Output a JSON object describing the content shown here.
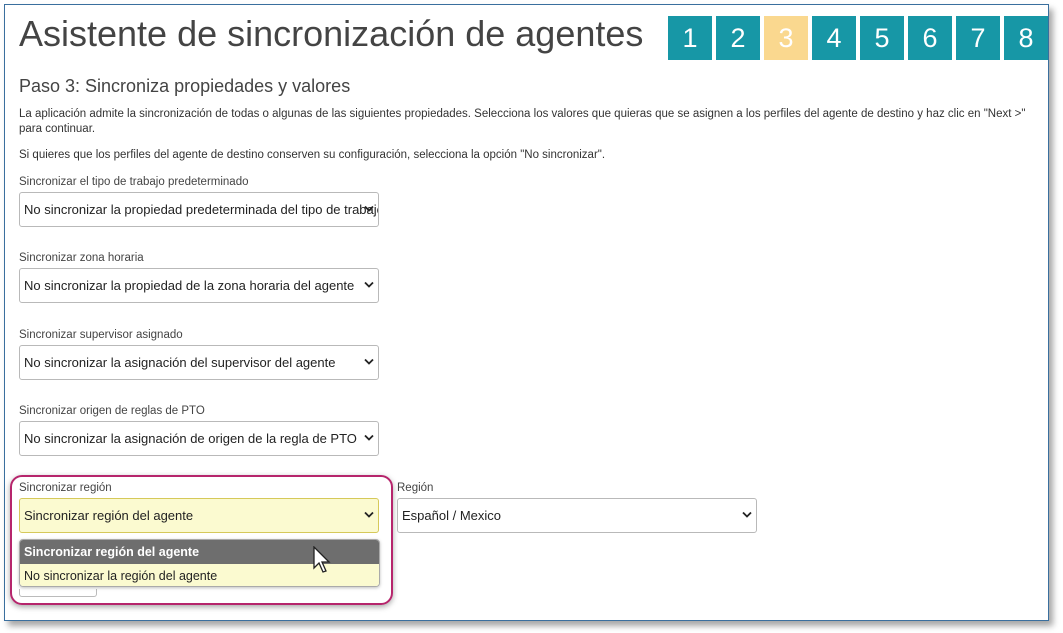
{
  "title": "Asistente de sincronización de agentes",
  "steps": [
    "1",
    "2",
    "3",
    "4",
    "5",
    "6",
    "7",
    "8"
  ],
  "active_step": "3",
  "subtitle": "Paso 3: Sincroniza propiedades y valores",
  "paragraph1": "La aplicación admite la sincronización de todas o algunas de las siguientes propiedades. Selecciona los valores que quieras que se asignen a los perfiles del agente de destino y haz clic en \"Next >\" para continuar.",
  "paragraph2": "Si quieres que los perfiles del agente de destino conserven su configuración, selecciona la opción \"No sincronizar\".",
  "fields": {
    "work_type": {
      "label": "Sincronizar el tipo de trabajo predeterminado",
      "value": "No sincronizar la propiedad predeterminada del tipo de trabajo"
    },
    "timezone": {
      "label": "Sincronizar zona horaria",
      "value": "No sincronizar la propiedad de la zona horaria del agente"
    },
    "supervisor": {
      "label": "Sincronizar supervisor asignado",
      "value": "No sincronizar la asignación del supervisor del agente"
    },
    "pto": {
      "label": "Sincronizar origen de reglas de PTO",
      "value": "No sincronizar la asignación de origen de la regla de PTO"
    },
    "region_sync": {
      "label": "Sincronizar región",
      "value": "Sincronizar región del agente",
      "options": [
        "Sincronizar región del agente",
        "No sincronizar la región del agente"
      ]
    },
    "region": {
      "label": "Región",
      "value": "Español / Mexico"
    }
  },
  "colors": {
    "step": "#1797a6",
    "step_active": "#fad88f",
    "highlight": "#b6256c",
    "field_highlight": "#fbfad0"
  },
  "icons": {
    "select_arrow": "chevron-down-icon",
    "pointer": "mouse-cursor-icon"
  }
}
